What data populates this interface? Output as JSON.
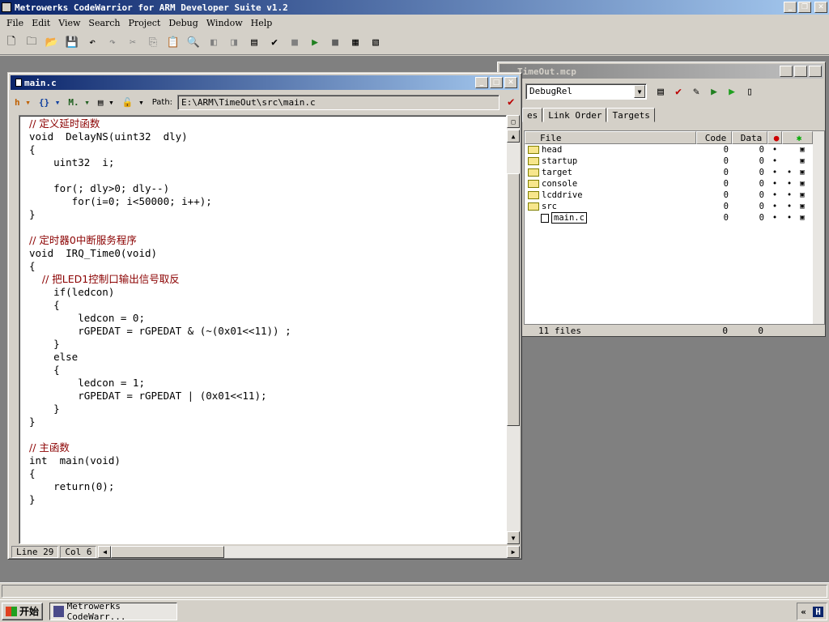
{
  "app": {
    "title": "Metrowerks CodeWarrior for ARM Developer Suite v1.2"
  },
  "menu": [
    "File",
    "Edit",
    "View",
    "Search",
    "Project",
    "Debug",
    "Window",
    "Help"
  ],
  "toolbar": {
    "icons": [
      "new-file-icon",
      "new-project-icon",
      "open-icon",
      "save-icon",
      "undo-icon",
      "redo-icon",
      "cut-icon",
      "copy-icon",
      "paste-icon",
      "find-icon",
      "back-icon",
      "forward-icon",
      "list-icon",
      "make-icon",
      "stop-icon",
      "debug-icon",
      "run-icon",
      "disasm-icon",
      "prefs-icon"
    ]
  },
  "editor": {
    "title": "main.c",
    "path_label": "Path:",
    "path": "E:\\ARM\\TimeOut\\src\\main.c",
    "toolbar_labels": {
      "functions": "{}",
      "markers": "M.",
      "header": "h"
    },
    "lines": [
      {
        "t": "// 定义延时函数",
        "c": true
      },
      {
        "t": "void  DelayNS(uint32  dly)"
      },
      {
        "t": "{"
      },
      {
        "t": "    uint32  i;"
      },
      {
        "t": ""
      },
      {
        "t": "    for(; dly>0; dly--)"
      },
      {
        "t": "       for(i=0; i<50000; i++);"
      },
      {
        "t": "}"
      },
      {
        "t": ""
      },
      {
        "t": "// 定时器0中断服务程序",
        "c": true
      },
      {
        "t": "void  IRQ_Time0(void)"
      },
      {
        "t": "{"
      },
      {
        "t": "    // 把LED1控制口输出信号取反",
        "c": true
      },
      {
        "t": "    if(ledcon)"
      },
      {
        "t": "    {"
      },
      {
        "t": "        ledcon = 0;"
      },
      {
        "t": "        rGPEDAT = rGPEDAT & (~(0x01<<11)) ;"
      },
      {
        "t": "    }"
      },
      {
        "t": "    else"
      },
      {
        "t": "    {"
      },
      {
        "t": "        ledcon = 1;"
      },
      {
        "t": "        rGPEDAT = rGPEDAT | (0x01<<11);"
      },
      {
        "t": "    }"
      },
      {
        "t": "}"
      },
      {
        "t": ""
      },
      {
        "t": "// 主函数",
        "c": true
      },
      {
        "t": "int  main(void)"
      },
      {
        "t": "{"
      },
      {
        "t": "    return(0);"
      },
      {
        "t": "}"
      }
    ],
    "status": {
      "line": "Line 29",
      "col": "Col 6"
    }
  },
  "project": {
    "title": "TimeOut.mcp",
    "target": "DebugRel",
    "tabs": [
      "es",
      "Link Order",
      "Targets"
    ],
    "columns": {
      "file": "File",
      "code": "Code",
      "data": "Data"
    },
    "files": [
      {
        "name": "head",
        "type": "folder",
        "code": "0",
        "data": "0",
        "b1": "•",
        "b2": ""
      },
      {
        "name": "startup",
        "type": "folder",
        "code": "0",
        "data": "0",
        "b1": "•",
        "b2": ""
      },
      {
        "name": "target",
        "type": "folder",
        "code": "0",
        "data": "0",
        "b1": "•",
        "b2": "•"
      },
      {
        "name": "console",
        "type": "folder",
        "code": "0",
        "data": "0",
        "b1": "•",
        "b2": "•"
      },
      {
        "name": "lcddrive",
        "type": "folder",
        "code": "0",
        "data": "0",
        "b1": "•",
        "b2": "•"
      },
      {
        "name": "src",
        "type": "folder-open",
        "code": "0",
        "data": "0",
        "b1": "•",
        "b2": "•"
      },
      {
        "name": "main.c",
        "type": "file",
        "code": "0",
        "data": "0",
        "b1": "•",
        "b2": "•"
      }
    ],
    "footer": {
      "count": "11 files",
      "code": "0",
      "data": "0"
    }
  },
  "taskbar": {
    "start": "开始",
    "item": "Metrowerks CodeWarr...",
    "tray": "H"
  }
}
